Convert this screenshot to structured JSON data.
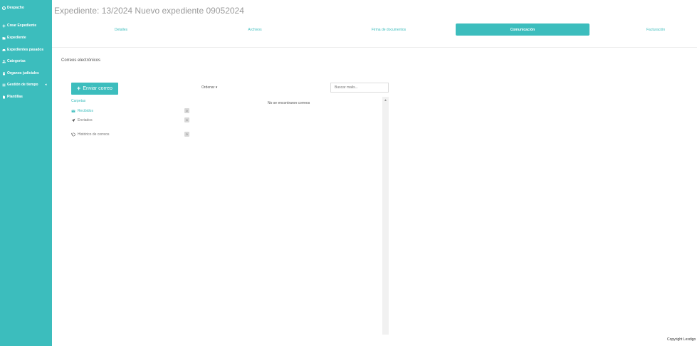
{
  "sidebar": {
    "items": [
      {
        "label": "Despacho",
        "icon": "dashboard-icon"
      },
      {
        "label": "Crear Expediente",
        "icon": "plus-icon"
      },
      {
        "label": "Expediente",
        "icon": "folder-icon"
      },
      {
        "label": "Expedientes pasados",
        "icon": "car-icon"
      },
      {
        "label": "Categorías",
        "icon": "users-icon"
      },
      {
        "label": "Organos judiciales",
        "icon": "building-icon"
      },
      {
        "label": "Gestión de tiempo",
        "icon": "list-icon"
      },
      {
        "label": "Plantillas",
        "icon": "file-icon"
      }
    ],
    "caret": "◂"
  },
  "header": {
    "title": "Expediente: 13/2024 Nuevo expediente 09052024"
  },
  "tabs": [
    {
      "label": "Detalles",
      "active": false
    },
    {
      "label": "Archivos",
      "active": false
    },
    {
      "label": "Firma de documentos",
      "active": false
    },
    {
      "label": "Comunicación",
      "active": true
    },
    {
      "label": "Facturación",
      "active": false
    }
  ],
  "mail": {
    "section_title": "Correos electrónicos",
    "send_button": "Enviar correo",
    "send_icon": "+",
    "folders_label": "Carpetas",
    "folders": [
      {
        "label": "Recibidos",
        "count": "0",
        "icon": "inbox-icon",
        "active": true
      },
      {
        "label": "Enviados",
        "count": "0",
        "icon": "send-icon",
        "active": false
      },
      {
        "label": "Histórico de correos",
        "count": "0",
        "icon": "history-icon",
        "active": false
      }
    ],
    "sort_label": "Ordenar ▾",
    "search_placeholder": "Buscar mails...",
    "empty_message": "No se encontraron correos",
    "scroll_up": "▲"
  },
  "footer": {
    "copyright": "Copyright Lexdigo"
  },
  "colors": {
    "accent": "#3cbdbd",
    "title_text": "#9a9a9a",
    "divider": "#ececec",
    "badge": "#d8d8d8"
  }
}
